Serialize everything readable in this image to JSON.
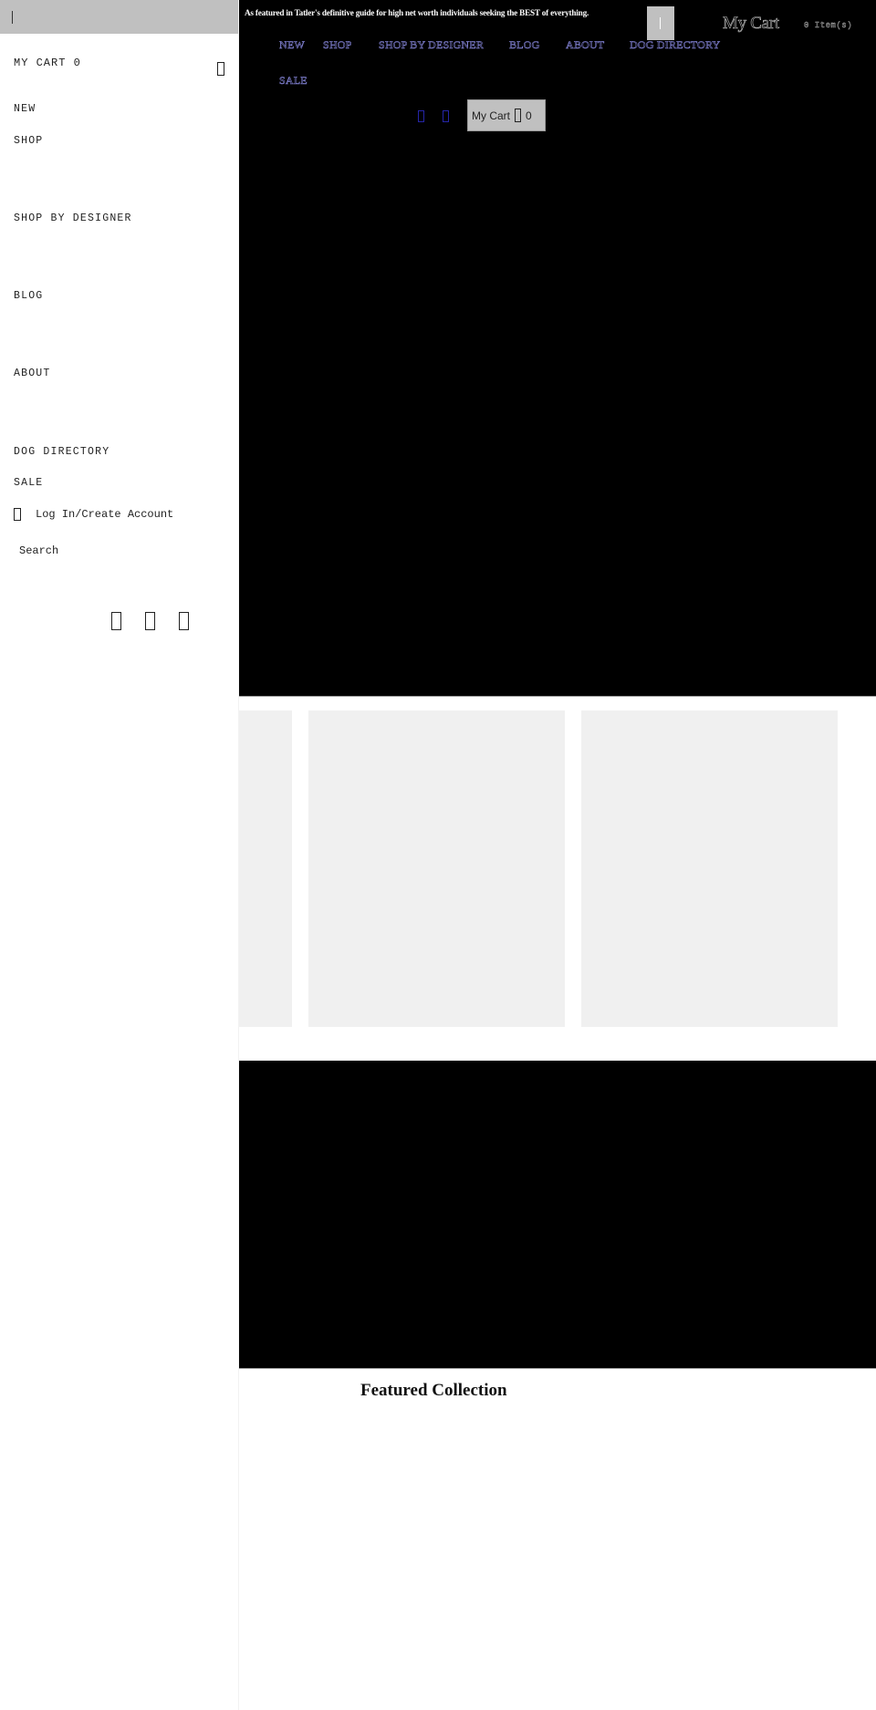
{
  "drawer": {
    "cart_label": "MY CART 0",
    "cart_icon": "shopping-bag-icon",
    "nav_items": [
      {
        "label": "NEW"
      },
      {
        "label": "SHOP"
      },
      {
        "label": "SHOP BY DESIGNER"
      },
      {
        "label": "BLOG"
      },
      {
        "label": "ABOUT"
      },
      {
        "label": "DOG DIRECTORY"
      },
      {
        "label": "SALE"
      }
    ],
    "login_label": "Log In/Create Account",
    "login_icon": "user-icon",
    "search_label": "Search",
    "social_icons": [
      "instagram-icon",
      "facebook-icon",
      "pinterest-icon"
    ]
  },
  "header": {
    "announcement": "As featured in Tatler's definitive guide for high net worth individuals seeking the BEST of everything.",
    "cart_title": "My Cart",
    "cart_count_text": "0 Item(s)",
    "nav_links": [
      {
        "label": "NEW"
      },
      {
        "label": "SHOP"
      },
      {
        "label": "SHOP BY DESIGNER"
      },
      {
        "label": "BLOG"
      },
      {
        "label": "ABOUT"
      },
      {
        "label": "DOG DIRECTORY"
      },
      {
        "label": "SALE"
      }
    ],
    "cart_button": {
      "label": "My Cart",
      "count": "0"
    },
    "colors": {
      "nav_text_outline": "#8e8ee8",
      "hero_bg": "#000000",
      "drawer_top_bg": "#c0c0c0",
      "card_bg": "#f0f0f0"
    }
  },
  "main": {
    "featured_title": "Featured Collection"
  }
}
